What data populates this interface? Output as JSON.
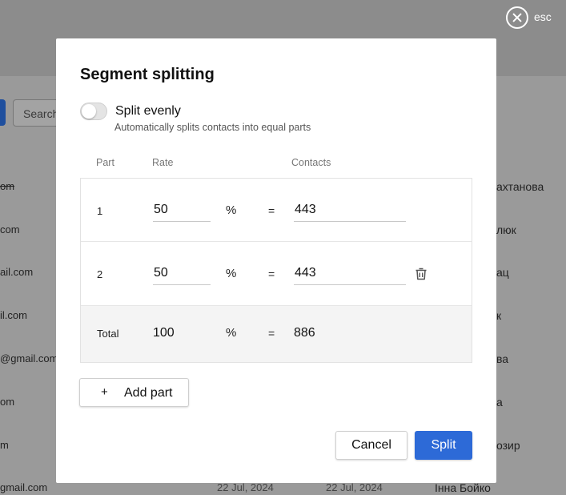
{
  "background": {
    "search_placeholder": "Search",
    "rows": [
      {
        "email": "om",
        "strike": true,
        "name": "ахтанова",
        "date1": "",
        "date2": "",
        "owner": ""
      },
      {
        "email": "com",
        "name": "люк",
        "date1": "",
        "date2": "",
        "owner": ""
      },
      {
        "email": "ail.com",
        "name": "ац",
        "date1": "",
        "date2": "",
        "owner": ""
      },
      {
        "email": "il.com",
        "name": "к",
        "date1": "",
        "date2": "",
        "owner": ""
      },
      {
        "email": "@gmail.com",
        "name": "ва",
        "date1": "",
        "date2": "",
        "owner": ""
      },
      {
        "email": "om",
        "name": "а",
        "date1": "",
        "date2": "",
        "owner": ""
      },
      {
        "email": "m",
        "name": "озир",
        "date1": "",
        "date2": "",
        "owner": ""
      },
      {
        "email": "gmail.com",
        "name": "",
        "date1": "22 Jul, 2024",
        "date2": "22 Jul, 2024",
        "owner": "Інна Бойко"
      }
    ]
  },
  "close": {
    "label": "esc"
  },
  "modal": {
    "title": "Segment splitting",
    "toggle_label": "Split evenly",
    "toggle_hint": "Automatically splits contacts into equal parts",
    "columns": {
      "part": "Part",
      "rate": "Rate",
      "contacts": "Contacts"
    },
    "rows": [
      {
        "part": "1",
        "rate": "50",
        "unit": "%",
        "eq": "=",
        "contacts": "443"
      },
      {
        "part": "2",
        "rate": "50",
        "unit": "%",
        "eq": "=",
        "contacts": "443"
      }
    ],
    "total": {
      "label": "Total",
      "rate": "100",
      "unit": "%",
      "eq": "=",
      "contacts": "886"
    },
    "add_part_label": "Add part",
    "add_part_icon": "+",
    "cancel_label": "Cancel",
    "split_label": "Split"
  },
  "colors": {
    "accent": "#2d6ad7"
  }
}
